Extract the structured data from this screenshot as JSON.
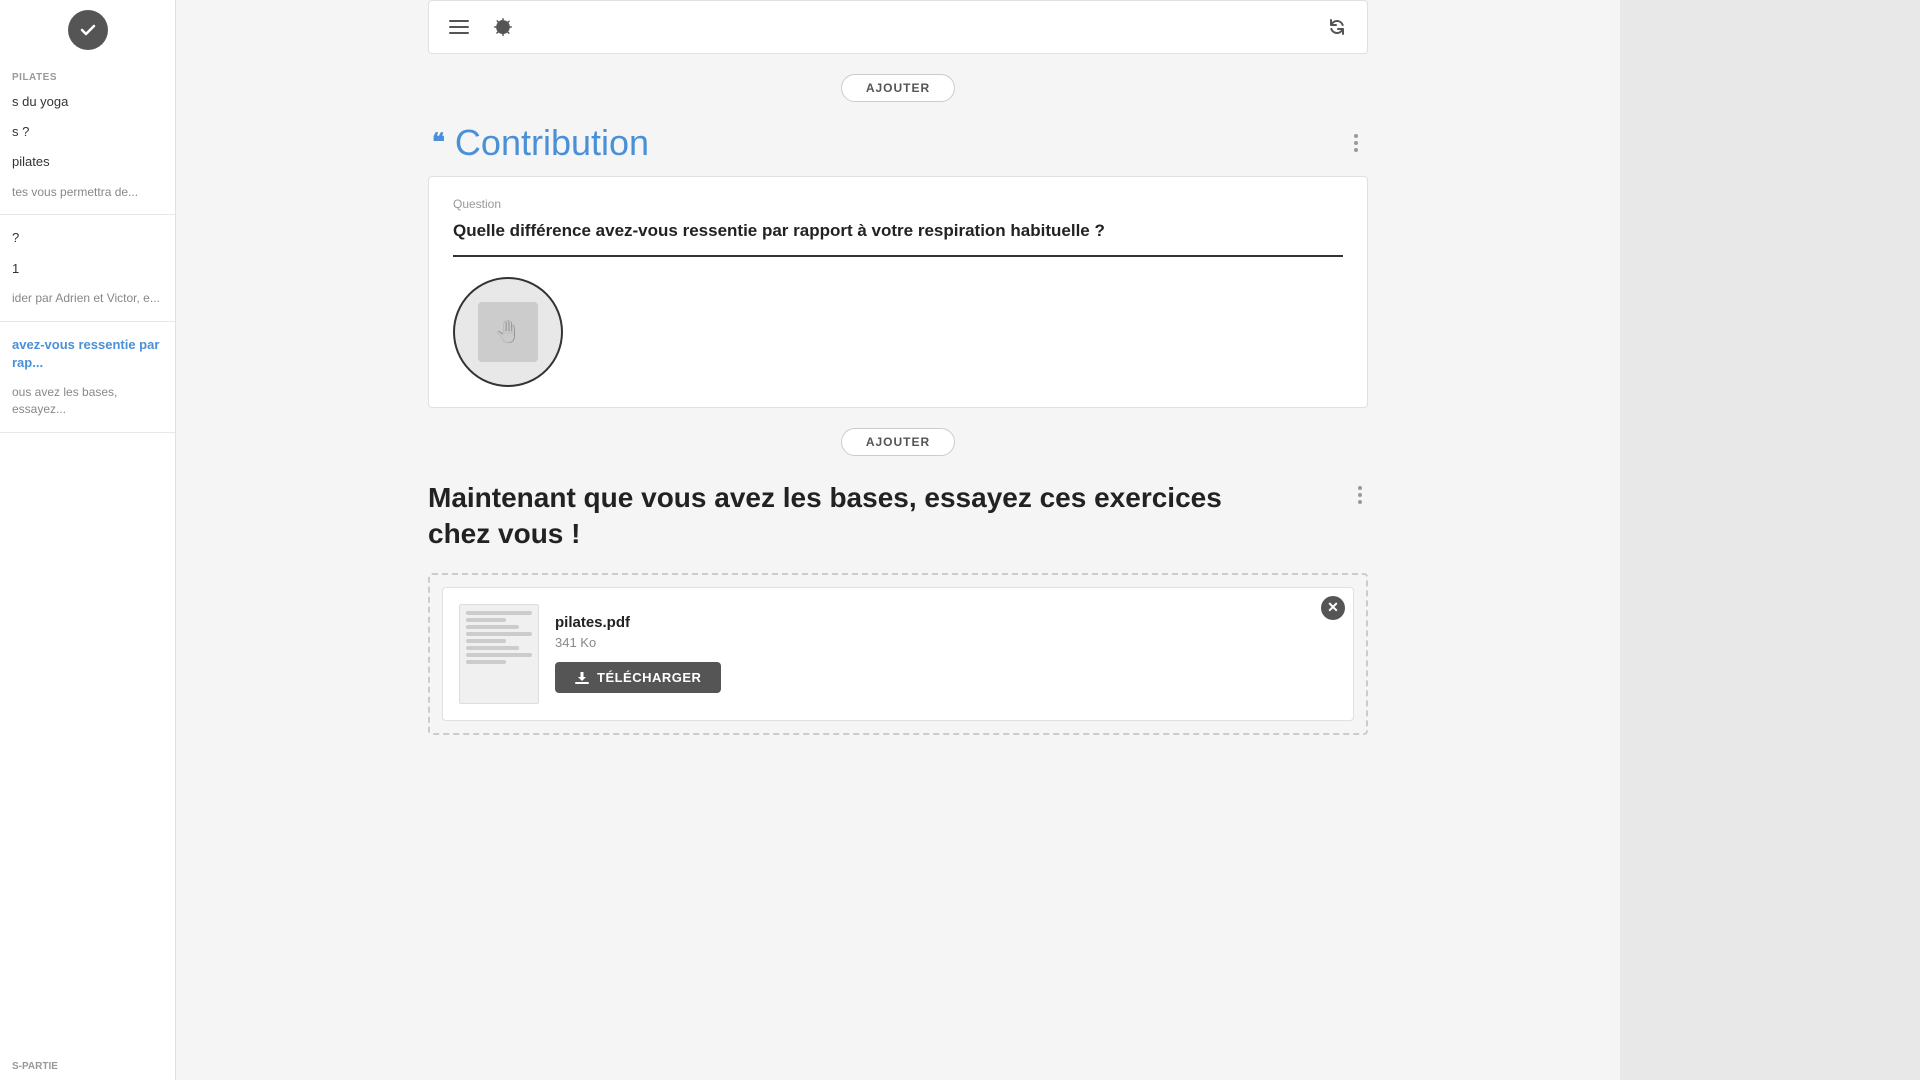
{
  "sidebar": {
    "check_label": "✓",
    "pilates_label": "PILATES",
    "items": [
      {
        "id": "yoga",
        "label": "s du yoga",
        "active": false
      },
      {
        "id": "q1",
        "label": "s ?",
        "active": false
      },
      {
        "id": "pilates",
        "label": "pilates",
        "active": false
      },
      {
        "id": "permettra",
        "label": "tes vous permettra de...",
        "active": false
      },
      {
        "id": "q2",
        "label": "?",
        "active": false
      },
      {
        "id": "num1",
        "label": "1",
        "active": false
      },
      {
        "id": "guider",
        "label": "ider par Adrien et Victor, e...",
        "active": false
      }
    ],
    "contribution_item": "avez-vous ressentie par rap...",
    "essayez_item": "ous avez les bases, essayez...",
    "bottom_section": "S-PARTIE"
  },
  "toolbar": {
    "menu_icon": "≡",
    "settings_icon": "⚙",
    "refresh_icon": "↺"
  },
  "ajouter_top": "AJOUTER",
  "contribution": {
    "quote_symbol": "❝",
    "title": "Contribution",
    "question_label": "Question",
    "question_text": "Quelle différence avez-vous ressentie par rapport à votre respiration habituelle ?",
    "avatar_placeholder": "🤚",
    "more_options_label": "⋮"
  },
  "ajouter_bottom": "AJOUTER",
  "section_text": {
    "title": "Maintenant que vous avez les bases, essayez ces exercices chez vous !",
    "more_options_label": "⋮"
  },
  "pdf": {
    "filename": "pilates.pdf",
    "size": "341 Ko",
    "download_label": "TÉLÉCHARGER",
    "close_label": "✕"
  }
}
